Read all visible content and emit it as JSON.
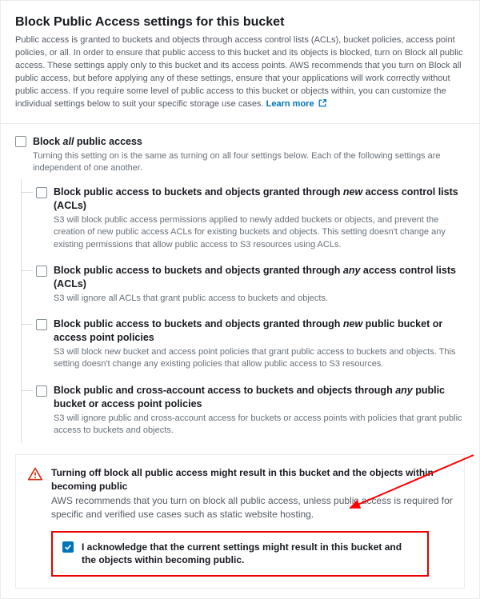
{
  "header": {
    "title": "Block Public Access settings for this bucket",
    "intro": "Public access is granted to buckets and objects through access control lists (ACLs), bucket policies, access point policies, or all. In order to ensure that public access to this bucket and its objects is blocked, turn on Block all public access. These settings apply only to this bucket and its access points. AWS recommends that you turn on Block all public access, but before applying any of these settings, ensure that your applications will work correctly without public access. If you require some level of public access to this bucket or objects within, you can customize the individual settings below to suit your specific storage use cases.",
    "learn_more": "Learn more"
  },
  "main_option": {
    "label_pre": "Block ",
    "label_italic": "all",
    "label_post": " public access",
    "desc": "Turning this setting on is the same as turning on all four settings below. Each of the following settings are independent of one another."
  },
  "sub_options": [
    {
      "label_pre": "Block public access to buckets and objects granted through ",
      "label_italic": "new",
      "label_post": " access control lists (ACLs)",
      "desc": "S3 will block public access permissions applied to newly added buckets or objects, and prevent the creation of new public access ACLs for existing buckets and objects. This setting doesn't change any existing permissions that allow public access to S3 resources using ACLs."
    },
    {
      "label_pre": "Block public access to buckets and objects granted through ",
      "label_italic": "any",
      "label_post": " access control lists (ACLs)",
      "desc": "S3 will ignore all ACLs that grant public access to buckets and objects."
    },
    {
      "label_pre": "Block public access to buckets and objects granted through ",
      "label_italic": "new",
      "label_post": " public bucket or access point policies",
      "desc": "S3 will block new bucket and access point policies that grant public access to buckets and objects. This setting doesn't change any existing policies that allow public access to S3 resources."
    },
    {
      "label_pre": "Block public and cross-account access to buckets and objects through ",
      "label_italic": "any",
      "label_post": " public bucket or access point policies",
      "desc": "S3 will ignore public and cross-account access for buckets or access points with policies that grant public access to buckets and objects."
    }
  ],
  "warning": {
    "title": "Turning off block all public access might result in this bucket and the objects within becoming public",
    "desc": "AWS recommends that you turn on block all public access, unless public access is required for specific and verified use cases such as static website hosting.",
    "ack": "I acknowledge that the current settings might result in this bucket and the objects within becoming public."
  }
}
